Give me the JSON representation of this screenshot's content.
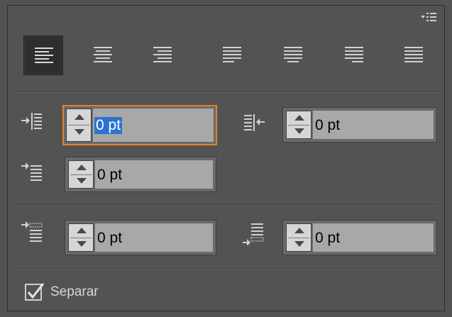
{
  "panel": {
    "menu_icon": "panel-menu-icon",
    "alignment_buttons": [
      {
        "name": "align-left",
        "icon": "align-left-icon",
        "active": true
      },
      {
        "name": "align-center",
        "icon": "align-center-icon",
        "active": false
      },
      {
        "name": "align-right",
        "icon": "align-right-icon",
        "active": false
      },
      {
        "name": "justify-last-left",
        "icon": "justify-last-left-icon",
        "active": false
      },
      {
        "name": "justify-last-center",
        "icon": "justify-last-center-icon",
        "active": false
      },
      {
        "name": "justify-last-right",
        "icon": "justify-last-right-icon",
        "active": false
      },
      {
        "name": "justify-all",
        "icon": "justify-all-icon",
        "active": false
      }
    ],
    "fields": {
      "indent_left": {
        "value": "0 pt",
        "focused": true,
        "icon": "indent-left-icon"
      },
      "indent_right": {
        "value": "0 pt",
        "focused": false,
        "icon": "indent-right-icon"
      },
      "indent_first_line": {
        "value": "0 pt",
        "focused": false,
        "icon": "indent-first-line-icon"
      },
      "space_before": {
        "value": "0 pt",
        "focused": false,
        "icon": "space-before-icon"
      },
      "space_after": {
        "value": "0 pt",
        "focused": false,
        "icon": "space-after-icon"
      }
    },
    "hyphenate": {
      "label": "Separar",
      "checked": true
    },
    "colors": {
      "background": "#535353",
      "focus": "#e1851f",
      "selection": "#2b72d1"
    }
  }
}
